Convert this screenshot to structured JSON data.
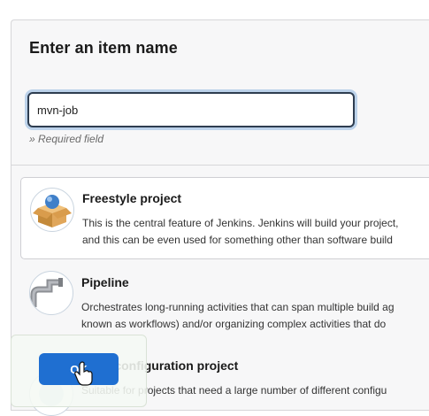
{
  "form": {
    "title": "Enter an item name",
    "item_name_value": "mvn-job",
    "required_note": "» Required field"
  },
  "item_types": [
    {
      "name": "Freestyle project",
      "icon": "freestyle-project-icon",
      "description_line1": "This is the central feature of Jenkins. Jenkins will build your project,",
      "description_line2": "and this can be even used for something other than software build",
      "selected": true
    },
    {
      "name": "Pipeline",
      "icon": "pipeline-icon",
      "description_line1": "Orchestrates long-running activities that can span multiple build ag",
      "description_line2": "known as workflows) and/or organizing complex activities that do",
      "selected": false
    },
    {
      "name": "Multi-configuration project",
      "icon": "multi-configuration-project-icon",
      "description_line1": "Suitable for projects that need a large number of different configu",
      "selected": false
    }
  ],
  "footer": {
    "ok_label": "OK"
  },
  "colors": {
    "accent": "#1f6fd1",
    "panel_bg": "#f7f7f8",
    "input_focus_ring": "#bcd2ea"
  }
}
